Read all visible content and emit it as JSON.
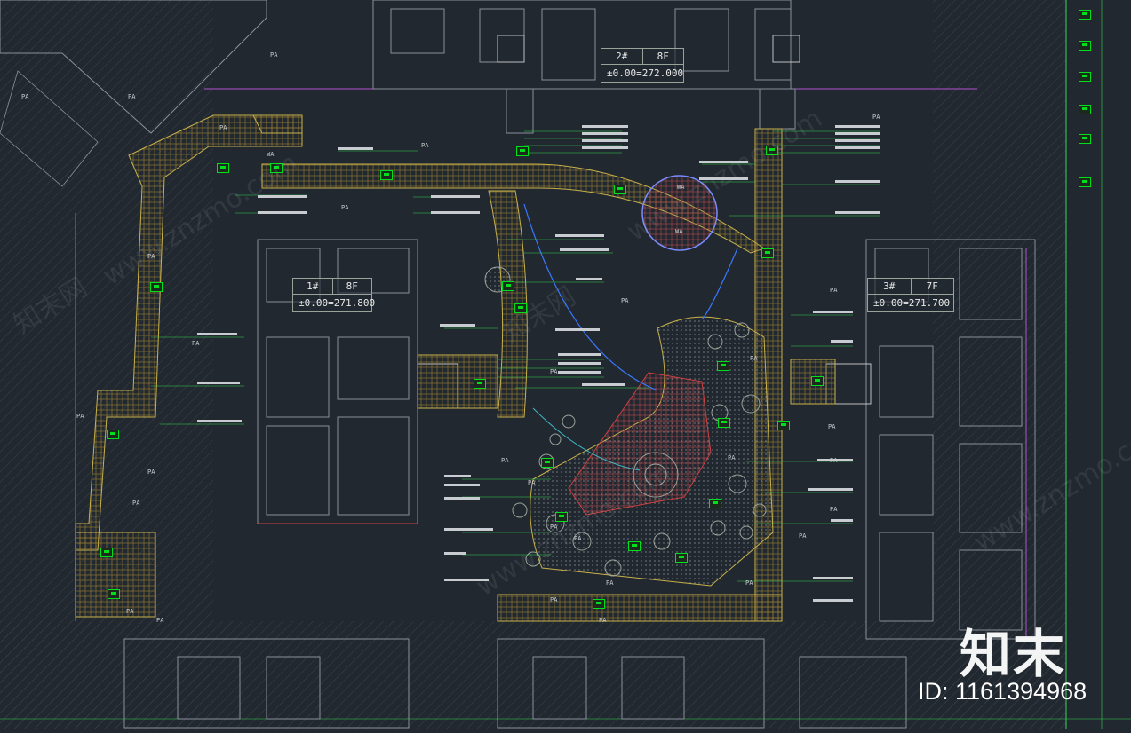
{
  "buildings": [
    {
      "id": "b2",
      "num": "2#",
      "floors": "8F",
      "elevation": "±0.00=272.000"
    },
    {
      "id": "b1",
      "num": "1#",
      "floors": "8F",
      "elevation": "±0.00=271.800"
    },
    {
      "id": "b3",
      "num": "3#",
      "floors": "7F",
      "elevation": "±0.00=271.700"
    }
  ],
  "zone_labels": {
    "pa": "PA",
    "wa": "WA"
  },
  "watermark": {
    "brand": "知末",
    "id_text": "ID: 1161394968",
    "site_text": "www.znzmo.com",
    "cn_text": "知末网"
  },
  "colors": {
    "background": "#212830",
    "tag_fill": "#00e01a",
    "paving": "#c9b24a",
    "dim_line": "#39d353",
    "wall": "#8c8f9a"
  }
}
